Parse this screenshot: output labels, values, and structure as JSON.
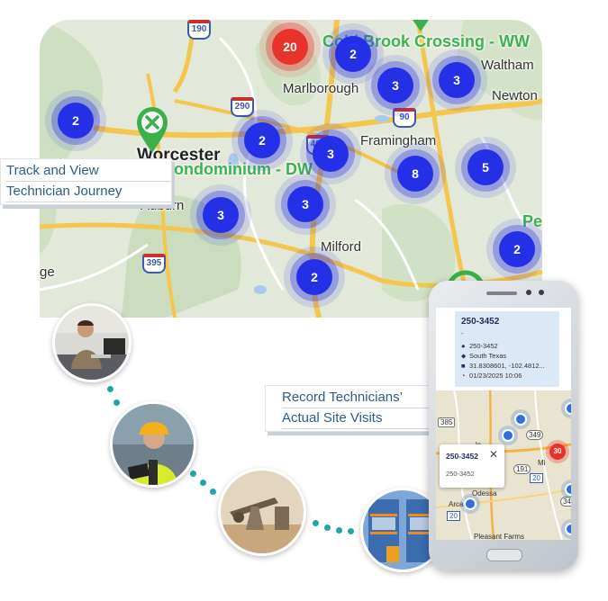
{
  "map": {
    "towns": [
      "Marlborough",
      "Waltham",
      "Newton",
      "Framingham",
      "Worcester",
      "Auburn",
      "Milford",
      "ge"
    ],
    "sites": [
      "Cold Brook Crossing - WW",
      "Condominium - DW",
      "Pe"
    ],
    "routes": [
      "190",
      "290",
      "90",
      "495",
      "395"
    ],
    "clusters": [
      "20",
      "2",
      "3",
      "3",
      "2",
      "2",
      "3",
      "8",
      "5",
      "3",
      "3",
      "2",
      "2"
    ]
  },
  "callouts": {
    "journey": [
      "Track and View",
      "Technician Journey"
    ],
    "visits": [
      "Record Technicians’",
      "Actual Site Visits"
    ]
  },
  "phone": {
    "title": "250-3452",
    "dash": "-",
    "rows": [
      "250-3452",
      "South Texas",
      "31.8308601, -102.4812...",
      "01/23/2025 10:06"
    ],
    "popup_title": "250-3452",
    "popup_sub": "250-3452",
    "popup_close": "✕",
    "cluster": "30",
    "places": [
      "Odessa",
      "Arcade",
      "Pleasant Farms",
      "le",
      "Mi"
    ],
    "roads": [
      "385",
      "349",
      "191",
      "20",
      "349",
      "20"
    ]
  }
}
